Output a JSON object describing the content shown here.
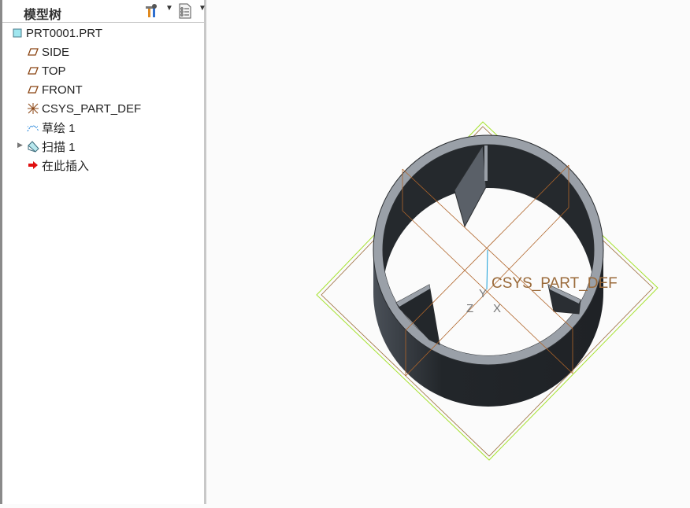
{
  "panel": {
    "title": "模型树"
  },
  "tree": [
    {
      "label": "PRT0001.PRT",
      "icon": "part-icon"
    },
    {
      "label": "SIDE",
      "icon": "datum-plane-icon"
    },
    {
      "label": "TOP",
      "icon": "datum-plane-icon"
    },
    {
      "label": "FRONT",
      "icon": "datum-plane-icon"
    },
    {
      "label": "CSYS_PART_DEF",
      "icon": "csys-icon"
    },
    {
      "label": "草绘 1",
      "icon": "sketch-icon"
    },
    {
      "label": "扫描 1",
      "icon": "sweep-icon"
    },
    {
      "label": "在此插入",
      "icon": "insert-here-arrow-icon"
    }
  ],
  "viewport": {
    "csys_label": "CSYS_PART_DEF",
    "axis_x": "X",
    "axis_y": "Y",
    "axis_z": "Z"
  },
  "colors": {
    "datum": "#9a6a3a",
    "green": "#a6e22e",
    "body": "#222528",
    "rim": "#9aa0a8"
  }
}
